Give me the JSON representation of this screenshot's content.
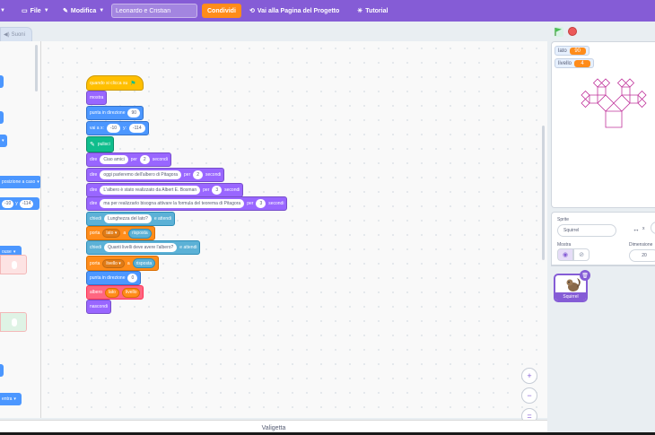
{
  "menubar": {
    "file_label": "File",
    "edit_label": "Modifica",
    "project_title": "Leonardo e Cristian",
    "share_label": "Condividi",
    "project_page_label": "Vai alla Pagina del Progetto",
    "tutorial_label": "Tutorial"
  },
  "tabs": {
    "sounds": "Suoni"
  },
  "palette": {
    "goto_random": "posizione a caso",
    "glide_x": "-10",
    "glide_y_label": "y",
    "glide_y": "-114",
    "mouse_label": "ouse",
    "slot1": "",
    "slot2": "",
    "center_label": "entra"
  },
  "script": [
    {
      "id": "when_flag",
      "text": "quando si clicca su"
    },
    {
      "id": "show",
      "text": "mostra"
    },
    {
      "id": "point_dir",
      "text": "punta in direzione",
      "value": "90"
    },
    {
      "id": "goto_xy",
      "text": "vai a x:",
      "x": "-10",
      "y_label": "y:",
      "y": "-114"
    },
    {
      "id": "clear",
      "text": "pulisci"
    },
    {
      "id": "say1",
      "text": "dire",
      "msg": "Ciao amici",
      "for": "per",
      "secs": "2",
      "unit": "secondi"
    },
    {
      "id": "say2",
      "text": "dire",
      "msg": "oggi parleremo dell'albero di Pitagora",
      "for": "per",
      "secs": "2",
      "unit": "secondi"
    },
    {
      "id": "say3",
      "text": "dire",
      "msg": "L'albero è stato realizzato da Albert E. Bosman",
      "for": "per",
      "secs": "3",
      "unit": "secondi"
    },
    {
      "id": "say4",
      "text": "dire",
      "msg": "ma per realizzarlo bisogna attivare la formula del teorema di Pitagora",
      "for": "per",
      "secs": "3",
      "unit": "secondi"
    },
    {
      "id": "ask1",
      "text": "chiedi",
      "msg": "Lunghezza del lato?",
      "after": "e attendi"
    },
    {
      "id": "set1",
      "text": "porta",
      "var": "lato",
      "to": "a",
      "rep": "risposta"
    },
    {
      "id": "ask2",
      "text": "chiedi",
      "msg": "Quanti livelli deve avere l'albero?",
      "after": "e attendi"
    },
    {
      "id": "set2",
      "text": "porta",
      "var": "livello",
      "to": "a",
      "rep": "risposta"
    },
    {
      "id": "point_dir2",
      "text": "punta in direzione",
      "value": "0"
    },
    {
      "id": "tree",
      "text": "albero",
      "a1": "lato",
      "a2": "livello"
    },
    {
      "id": "hide",
      "text": "nascondi"
    }
  ],
  "zoom": {
    "in": "+",
    "out": "−",
    "reset": "="
  },
  "backpack_label": "Valigetta",
  "stage": {
    "monitors": [
      {
        "label": "lato",
        "value": "90"
      },
      {
        "label": "livello",
        "value": "4"
      }
    ],
    "line_color": "#c0339b"
  },
  "sprite_info": {
    "sprite_label": "Sprite",
    "sprite_name": "Squirrel",
    "x_label": "x",
    "show_label": "Mostra",
    "size_label": "Dimensione",
    "size_value": "20"
  },
  "sprites": [
    {
      "name": "Squirrel"
    }
  ],
  "colors": {
    "menubar": "#855cd6",
    "share": "#ff8c1a",
    "events": "#ffbf00",
    "looks": "#9966ff",
    "motion": "#4c97ff",
    "pen": "#0fbd8c",
    "sensing": "#5cb1d6",
    "variables": "#ff8c1a",
    "myblocks": "#ff6680"
  }
}
